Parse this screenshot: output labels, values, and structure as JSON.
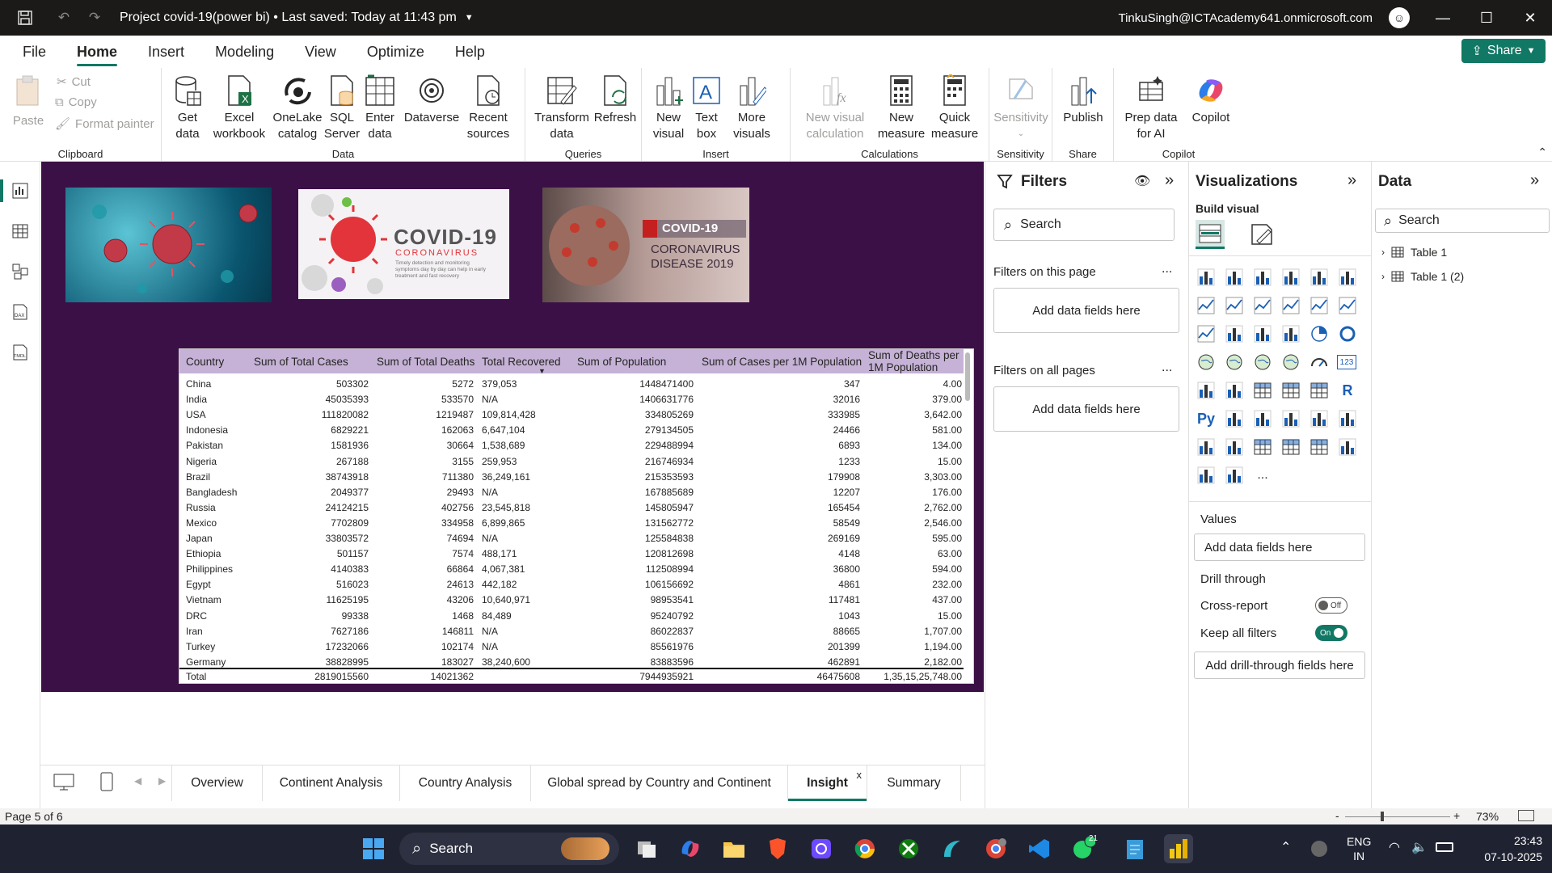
{
  "titlebar": {
    "title": "Project covid-19(power bi) • Last saved: Today at 11:43 pm",
    "user": "TinkuSingh@ICTAcademy641.onmicrosoft.com"
  },
  "menu": [
    "File",
    "Home",
    "Insert",
    "Modeling",
    "View",
    "Optimize",
    "Help"
  ],
  "share_label": "Share",
  "ribbon": {
    "clipboard": {
      "paste": "Paste",
      "cut": "Cut",
      "copy": "Copy",
      "format_painter": "Format painter",
      "label": "Clipboard"
    },
    "data": {
      "get_data": "Get data",
      "excel": "Excel workbook",
      "onelake": "OneLake catalog",
      "sql": "SQL Server",
      "enter": "Enter data",
      "dataverse": "Dataverse",
      "recent": "Recent sources",
      "label": "Data"
    },
    "queries": {
      "transform": "Transform data",
      "refresh": "Refresh",
      "label": "Queries"
    },
    "insert": {
      "new_visual": "New visual",
      "text_box": "Text box",
      "more_visuals": "More visuals",
      "label": "Insert"
    },
    "calculations": {
      "new_visual_calc": "New visual calculation",
      "new_measure": "New measure",
      "quick_measure": "Quick measure",
      "label": "Calculations"
    },
    "sensitivity": {
      "btn": "Sensitivity",
      "label": "Sensitivity"
    },
    "share": {
      "publish": "Publish",
      "label": "Share"
    },
    "copilot": {
      "prep": "Prep data for AI",
      "copilot": "Copilot",
      "label": "Copilot"
    }
  },
  "images": {
    "img2_title": "COVID-19",
    "img2_sub": "CORONAVIRUS",
    "img2_text": "Timely detection and monitoring symptoms day by day can help in early treatment and fast recovery",
    "img3_title": "COVID-19",
    "img3_sub1": "CORONAVIRUS",
    "img3_sub2": "DISEASE 2019"
  },
  "table": {
    "headers": [
      "Country",
      "Sum of Total Cases",
      "Sum of Total Deaths",
      "Total Recovered",
      "Sum of Population",
      "Sum of Cases per 1M Population",
      "Sum of Deaths per 1M Population"
    ],
    "rows": [
      [
        "China",
        "503302",
        "5272",
        "379,053",
        "1448471400",
        "347",
        "4.00"
      ],
      [
        "India",
        "45035393",
        "533570",
        "N/A",
        "1406631776",
        "32016",
        "379.00"
      ],
      [
        "USA",
        "111820082",
        "1219487",
        "109,814,428",
        "334805269",
        "333985",
        "3,642.00"
      ],
      [
        "Indonesia",
        "6829221",
        "162063",
        "6,647,104",
        "279134505",
        "24466",
        "581.00"
      ],
      [
        "Pakistan",
        "1581936",
        "30664",
        "1,538,689",
        "229488994",
        "6893",
        "134.00"
      ],
      [
        "Nigeria",
        "267188",
        "3155",
        "259,953",
        "216746934",
        "1233",
        "15.00"
      ],
      [
        "Brazil",
        "38743918",
        "711380",
        "36,249,161",
        "215353593",
        "179908",
        "3,303.00"
      ],
      [
        "Bangladesh",
        "2049377",
        "29493",
        "N/A",
        "167885689",
        "12207",
        "176.00"
      ],
      [
        "Russia",
        "24124215",
        "402756",
        "23,545,818",
        "145805947",
        "165454",
        "2,762.00"
      ],
      [
        "Mexico",
        "7702809",
        "334958",
        "6,899,865",
        "131562772",
        "58549",
        "2,546.00"
      ],
      [
        "Japan",
        "33803572",
        "74694",
        "N/A",
        "125584838",
        "269169",
        "595.00"
      ],
      [
        "Ethiopia",
        "501157",
        "7574",
        "488,171",
        "120812698",
        "4148",
        "63.00"
      ],
      [
        "Philippines",
        "4140383",
        "66864",
        "4,067,381",
        "112508994",
        "36800",
        "594.00"
      ],
      [
        "Egypt",
        "516023",
        "24613",
        "442,182",
        "106156692",
        "4861",
        "232.00"
      ],
      [
        "Vietnam",
        "11625195",
        "43206",
        "10,640,971",
        "98953541",
        "117481",
        "437.00"
      ],
      [
        "DRC",
        "99338",
        "1468",
        "84,489",
        "95240792",
        "1043",
        "15.00"
      ],
      [
        "Iran",
        "7627186",
        "146811",
        "N/A",
        "86022837",
        "88665",
        "1,707.00"
      ],
      [
        "Turkey",
        "17232066",
        "102174",
        "N/A",
        "85561976",
        "201399",
        "1,194.00"
      ],
      [
        "Germany",
        "38828995",
        "183027",
        "38,240,600",
        "83883596",
        "462891",
        "2,182.00"
      ]
    ],
    "total": [
      "Total",
      "2819015560",
      "14021362",
      "",
      "7944935921",
      "46475608",
      "1,35,15,25,748.00"
    ]
  },
  "pages": {
    "tabs": [
      "Overview",
      "Continent Analysis",
      "Country Analysis",
      "Global spread by Country and Continent",
      "Insight",
      "Summary"
    ],
    "active": "Insight",
    "close_glyph": "x",
    "add_glyph": "+",
    "status": "Page 5 of 6",
    "zoom": "73%"
  },
  "filters": {
    "title": "Filters",
    "search": "Search",
    "this_page": "Filters on this page",
    "all_pages": "Filters on all pages",
    "add_fields": "Add data fields here",
    "more": "..."
  },
  "viz": {
    "title": "Visualizations",
    "build": "Build visual",
    "values": "Values",
    "add_fields": "Add data fields here",
    "drill": "Drill through",
    "cross_report": "Cross-report",
    "cross_state": "Off",
    "keep_filters": "Keep all filters",
    "keep_state": "On",
    "add_drill": "Add drill-through fields here",
    "r_label": "R",
    "py_label": "Py",
    "num_label": "123",
    "more": "..."
  },
  "datapane": {
    "title": "Data",
    "search": "Search",
    "tables": [
      "Table 1",
      "Table 1 (2)"
    ]
  },
  "taskbar": {
    "search": "Search",
    "lang1": "ENG",
    "lang2": "IN",
    "time": "23:43",
    "date": "07-10-2025",
    "badge": "21"
  },
  "colors": {
    "accent": "#117865",
    "report_bg": "#3b1046",
    "table_header": "#c5b2d6"
  }
}
